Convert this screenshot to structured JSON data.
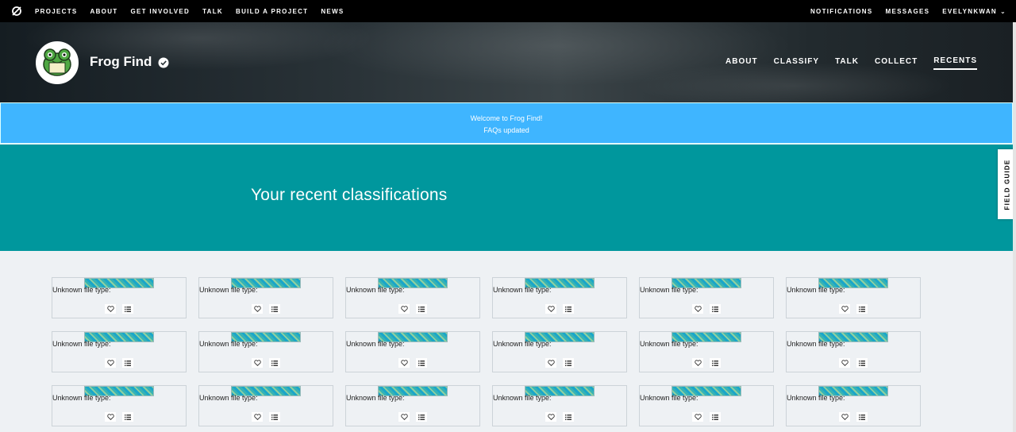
{
  "topbar": {
    "left_links": [
      "PROJECTS",
      "ABOUT",
      "GET INVOLVED",
      "TALK",
      "BUILD A PROJECT",
      "NEWS"
    ],
    "right_links": [
      "NOTIFICATIONS",
      "MESSAGES",
      "EVELYNKWAN"
    ]
  },
  "project": {
    "title": "Frog Find",
    "nav": [
      {
        "label": "ABOUT"
      },
      {
        "label": "CLASSIFY"
      },
      {
        "label": "TALK"
      },
      {
        "label": "COLLECT"
      },
      {
        "label": "RECENTS",
        "active": true
      }
    ]
  },
  "announcement": {
    "line1": "Welcome to Frog Find!",
    "line2": "FAQs updated"
  },
  "page": {
    "heading": "Your recent classifications",
    "field_guide": "FIELD GUIDE"
  },
  "cards": {
    "label": "Unknown file type:",
    "rows": 3,
    "columns": 6,
    "actions": [
      "heart-icon",
      "list-icon"
    ]
  },
  "colors": {
    "topbar": "#000000",
    "announcement": "#3fb5ff",
    "teal": "#00979d",
    "page_bg": "#eef1f4"
  }
}
